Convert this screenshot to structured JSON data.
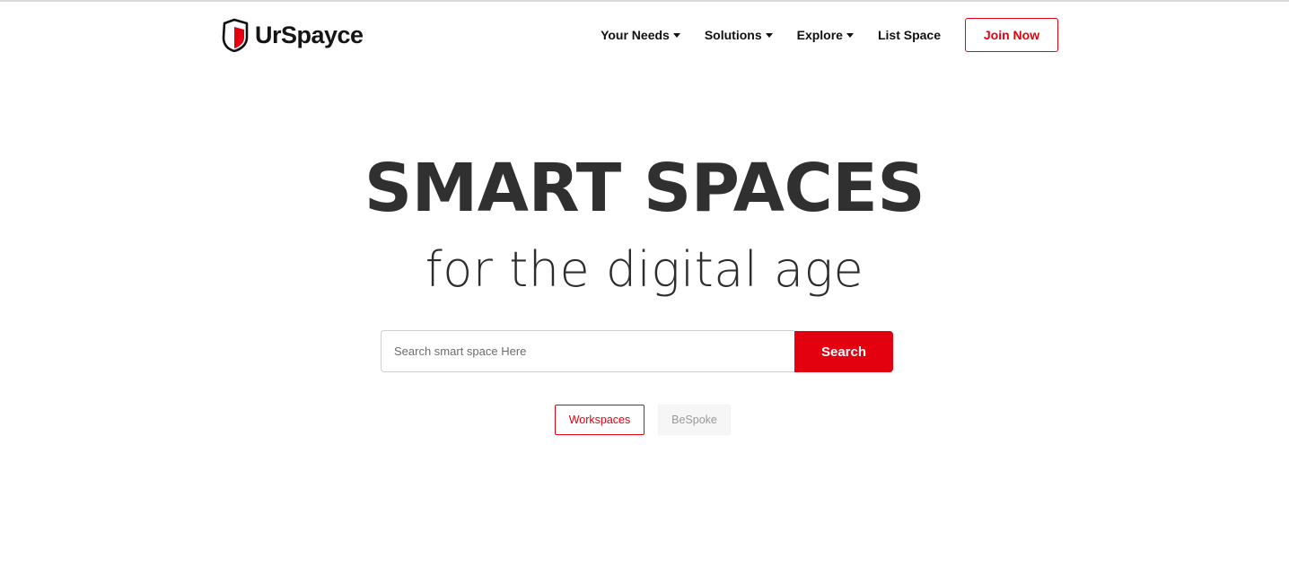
{
  "brand": {
    "name": "UrSpayce",
    "accent_color": "#e3000f"
  },
  "nav": {
    "items": [
      {
        "label": "Your Needs",
        "dropdown": true
      },
      {
        "label": "Solutions",
        "dropdown": true
      },
      {
        "label": "Explore",
        "dropdown": true
      },
      {
        "label": "List Space",
        "dropdown": false
      }
    ],
    "join_label": "Join Now"
  },
  "hero": {
    "title": "SMART SPACES",
    "subtitle": "for the digital age"
  },
  "search": {
    "placeholder": "Search smart space Here",
    "value": "",
    "button_label": "Search"
  },
  "categories": {
    "options": [
      "Workspaces",
      "BeSpoke"
    ],
    "selected": "Workspaces"
  }
}
